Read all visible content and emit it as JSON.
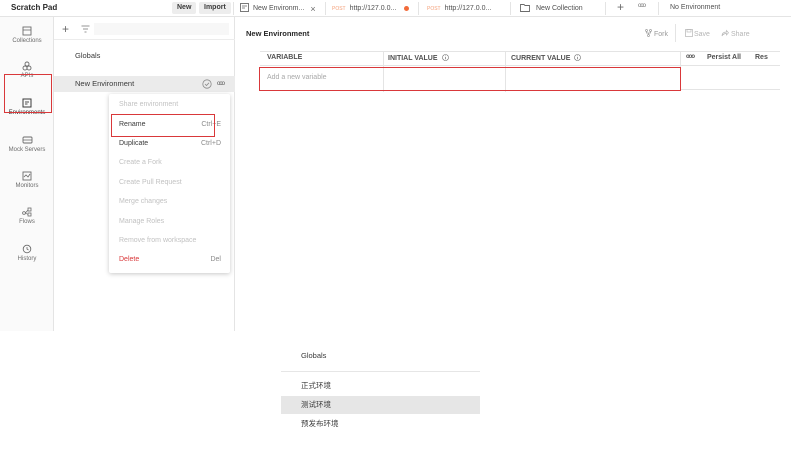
{
  "topbar": {
    "workspace_title": "Scratch Pad",
    "new_label": "New",
    "import_label": "Import",
    "tabs": [
      {
        "label": "New Environm...",
        "method": ""
      },
      {
        "label": "http://127.0.0...",
        "method": "POST"
      },
      {
        "label": "http://127.0.0...",
        "method": "POST"
      },
      {
        "label": "New Collection",
        "method": ""
      }
    ],
    "more_label": "ooo",
    "env_select_label": "No Environment"
  },
  "rail": {
    "items": [
      {
        "label": "Collections",
        "icon": "collections-icon"
      },
      {
        "label": "APIs",
        "icon": "apis-icon"
      },
      {
        "label": "Environments",
        "icon": "environments-icon"
      },
      {
        "label": "Mock Servers",
        "icon": "mock-servers-icon"
      },
      {
        "label": "Monitors",
        "icon": "monitors-icon"
      },
      {
        "label": "Flows",
        "icon": "flows-icon"
      },
      {
        "label": "History",
        "icon": "history-icon"
      }
    ]
  },
  "envlist": {
    "globals": "Globals",
    "env_name": "New Environment",
    "more": "ooo"
  },
  "context_menu": {
    "items": [
      {
        "label": "Share environment",
        "shortcut": "",
        "state": "disabled"
      },
      {
        "label": "Rename",
        "shortcut": "Ctrl+E",
        "state": "enabled"
      },
      {
        "label": "Duplicate",
        "shortcut": "Ctrl+D",
        "state": "enabled"
      },
      {
        "label": "Create a Fork",
        "shortcut": "",
        "state": "disabled"
      },
      {
        "label": "Create Pull Request",
        "shortcut": "",
        "state": "disabled"
      },
      {
        "label": "Merge changes",
        "shortcut": "",
        "state": "disabled"
      },
      {
        "label": "Manage Roles",
        "shortcut": "",
        "state": "disabled"
      },
      {
        "label": "Remove from workspace",
        "shortcut": "",
        "state": "disabled"
      },
      {
        "label": "Delete",
        "shortcut": "Del",
        "state": "danger"
      }
    ]
  },
  "main": {
    "title": "New Environment",
    "fork_label": "Fork",
    "save_label": "Save",
    "share_label": "Share",
    "columns": [
      "VARIABLE",
      "INITIAL VALUE",
      "CURRENT VALUE"
    ],
    "more_label": "ooo",
    "persist_all_label": "Persist All",
    "reset_label": "Res",
    "add_placeholder": "Add a new variable"
  },
  "popup": {
    "items": [
      "Globals",
      "正式环境",
      "测试环境",
      "预发布环境"
    ]
  }
}
